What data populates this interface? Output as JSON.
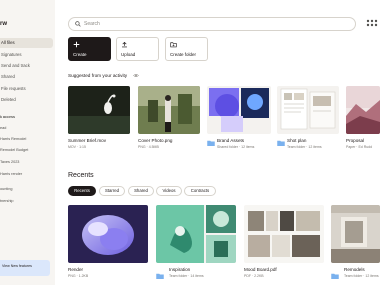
{
  "app": {
    "logo": "rw"
  },
  "sidebar": {
    "items": [
      {
        "label": "All files",
        "active": true
      },
      {
        "label": "Signatures"
      },
      {
        "label": "Send and track"
      },
      {
        "label": "Shared"
      },
      {
        "label": "File requests"
      },
      {
        "label": "Deleted"
      }
    ],
    "section_label": "k access",
    "starred": [
      "ead",
      "Harris Remodel",
      "Remodel Budget",
      "Taxes 2023",
      "Harris render"
    ],
    "extra": [
      "ounting",
      "tnership"
    ],
    "promo": "View New features"
  },
  "search": {
    "placeholder": "Search"
  },
  "actions": [
    {
      "label": "Create",
      "icon": "plus-icon"
    },
    {
      "label": "Upload",
      "icon": "upload-icon"
    },
    {
      "label": "Create folder",
      "icon": "folder-plus-icon"
    }
  ],
  "suggested": {
    "heading": "Suggested from your activity",
    "items": [
      {
        "name": "Summer Brief.mov",
        "meta": "MOV · 1:15"
      },
      {
        "name": "Cover Photo.png",
        "meta": "PNG · 4.5MB"
      },
      {
        "name": "Brand Assets",
        "meta": "Shared folder · 12 items"
      },
      {
        "name": "Shot plan",
        "meta": "Team folder · 12 items"
      },
      {
        "name": "Proposal",
        "meta": "Paper · Ed Rudd"
      }
    ]
  },
  "recents": {
    "title": "Recents",
    "tabs": [
      "Recents",
      "Starred",
      "Shared",
      "Videos",
      "Contracts"
    ],
    "items": [
      {
        "name": "Render",
        "meta": "PNG · 1.2KB"
      },
      {
        "name": "Inspiration",
        "meta": "Team folder · 14 items"
      },
      {
        "name": "Mood Board.pdf",
        "meta": "PDF · 2.2KB"
      },
      {
        "name": "Remodels",
        "meta": "Team folder · 12 items"
      }
    ]
  }
}
